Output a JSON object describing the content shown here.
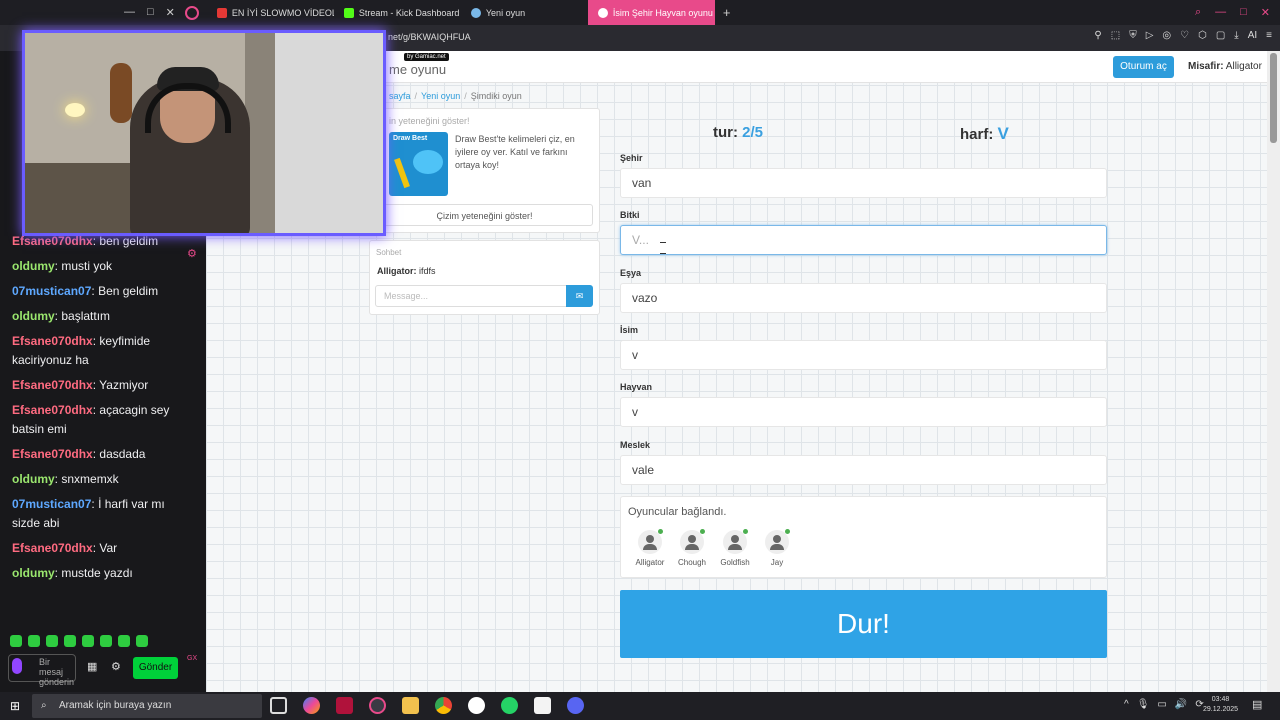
{
  "browser": {
    "tabs": [
      {
        "label": "EN İYİ SLOWMO VİDEOLA",
        "color": "#e53935",
        "active": false
      },
      {
        "label": "Stream - Kick Dashboard",
        "color": "#53fc18",
        "active": false
      },
      {
        "label": "Yeni oyun",
        "color": "#7ab8e8",
        "active": false
      },
      {
        "label": "İsim Şehir Hayvan oyunu",
        "color": "#ffffff",
        "active": true
      }
    ],
    "url": "net/g/BKWAIQHFUA",
    "ai_label": "AI"
  },
  "chat_panel": {
    "messages": [
      {
        "user": "Efsane070dhx",
        "color": "#ff6b81",
        "text": "ben geldim"
      },
      {
        "user": "oldumy",
        "color": "#9ae66e",
        "text": "musti yok"
      },
      {
        "user": "07mustican07",
        "color": "#5ea8ff",
        "text": "Ben geldim"
      },
      {
        "user": "oldumy",
        "color": "#9ae66e",
        "text": "başlattım"
      },
      {
        "user": "Efsane070dhx",
        "color": "#ff6b81",
        "text": "keyfimide kaciriyonuz ha"
      },
      {
        "user": "Efsane070dhx",
        "color": "#ff6b81",
        "text": "Yazmiyor"
      },
      {
        "user": "Efsane070dhx",
        "color": "#ff6b81",
        "text": "açacagin sey batsin emi"
      },
      {
        "user": "Efsane070dhx",
        "color": "#ff6b81",
        "text": "dasdada"
      },
      {
        "user": "oldumy",
        "color": "#9ae66e",
        "text": "snxmemxk"
      },
      {
        "user": "07mustican07",
        "color": "#5ea8ff",
        "text": "İ harfi var mı sizde abi"
      },
      {
        "user": "Efsane070dhx",
        "color": "#ff6b81",
        "text": "Var"
      },
      {
        "user": "oldumy",
        "color": "#9ae66e",
        "text": "mustde yazdı"
      }
    ],
    "input_placeholder": "Bir mesaj gönderin",
    "send_label": "Gönder",
    "gx_label": "GX"
  },
  "site": {
    "brand": "me oyunu",
    "by_label": "by Gamiac.net",
    "login_label": "Oturum aç",
    "guest_prefix": "Misafir:",
    "guest_name": "Alligator"
  },
  "breadcrumb": [
    "sayfa",
    "Yeni oyun",
    "Şimdiki oyun"
  ],
  "promo": {
    "title": "in yeteneğini göster!",
    "image_label": "Draw Best",
    "text": "Draw Best'te kelimeleri çiz, en iyilere oy ver. Katıl ve farkını ortaya koy!",
    "button_label": "Çizim yeteneğini göster!"
  },
  "room_chat": {
    "title": "Sohbet",
    "user": "Alligator:",
    "text": "ifdfs",
    "placeholder": "Message..."
  },
  "game": {
    "tur_label": "tur:",
    "tur_value": "2/5",
    "harf_label": "harf:",
    "harf_value": "V",
    "fields": [
      {
        "label": "Şehir",
        "value": "van",
        "placeholder": ""
      },
      {
        "label": "Bitki",
        "value": "",
        "placeholder": "V..."
      },
      {
        "label": "Eşya",
        "value": "vazo",
        "placeholder": ""
      },
      {
        "label": "İsim",
        "value": "v",
        "placeholder": ""
      },
      {
        "label": "Hayvan",
        "value": "v",
        "placeholder": ""
      },
      {
        "label": "Meslek",
        "value": "vale",
        "placeholder": ""
      }
    ],
    "players_title": "Oyuncular bağlandı.",
    "players": [
      "Alligator",
      "Chough",
      "Goldfish",
      "Jay"
    ],
    "stop_label": "Dur!"
  },
  "taskbar": {
    "search_placeholder": "Aramak için buraya yazın",
    "time": "03:48",
    "date": "29.12.2025"
  }
}
